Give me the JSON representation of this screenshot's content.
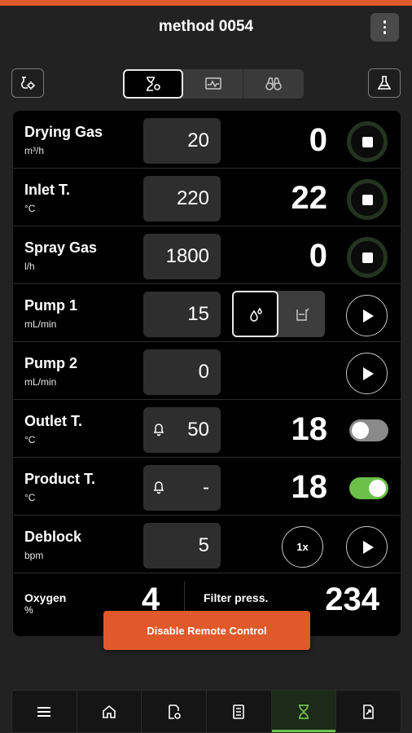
{
  "header": {
    "title": "method 0054"
  },
  "colors": {
    "accent": "#e0592a",
    "active_green": "#6cc04a",
    "toggle_off": "#8a8a8a"
  },
  "top_tabs": [
    {
      "icon": "hourglass-settings-icon",
      "active": true
    },
    {
      "icon": "monitor-chart-icon",
      "active": false
    },
    {
      "icon": "binoculars-icon",
      "active": false
    }
  ],
  "rows": [
    {
      "label": "Drying Gas",
      "unit": "m³/h",
      "setpoint": "20",
      "actual": "0",
      "control": "stop"
    },
    {
      "label": "Inlet T.",
      "unit": "°C",
      "setpoint": "220",
      "actual": "22",
      "control": "stop"
    },
    {
      "label": "Spray Gas",
      "unit": "l/h",
      "setpoint": "1800",
      "actual": "0",
      "control": "stop"
    },
    {
      "label": "Pump 1",
      "unit": "mL/min",
      "setpoint": "15",
      "actual": "",
      "control": "play"
    },
    {
      "label": "Pump 2",
      "unit": "mL/min",
      "setpoint": "0",
      "actual": "",
      "control": "play"
    },
    {
      "label": "Outlet T.",
      "unit": "°C",
      "setpoint": "50",
      "actual": "18",
      "control": "toggle",
      "toggle_on": false
    },
    {
      "label": "Product T.",
      "unit": "°C",
      "setpoint": "-",
      "actual": "18",
      "control": "toggle",
      "toggle_on": true
    },
    {
      "label": "Deblock",
      "unit": "bpm",
      "setpoint": "5",
      "actual": "",
      "control": "play",
      "multiplier": "1x"
    }
  ],
  "bottom": {
    "oxygen_label": "Oxygen",
    "oxygen_unit": "%",
    "oxygen_value": "4",
    "filter_label": "Filter press.",
    "filter_value": "234"
  },
  "toast": {
    "label": "Disable Remote Control"
  },
  "nav": [
    {
      "icon": "menu-icon",
      "active": false
    },
    {
      "icon": "home-icon",
      "active": false
    },
    {
      "icon": "document-settings-icon",
      "active": false
    },
    {
      "icon": "checklist-icon",
      "active": false
    },
    {
      "icon": "hourglass-icon",
      "active": true
    },
    {
      "icon": "document-export-icon",
      "active": false
    }
  ]
}
